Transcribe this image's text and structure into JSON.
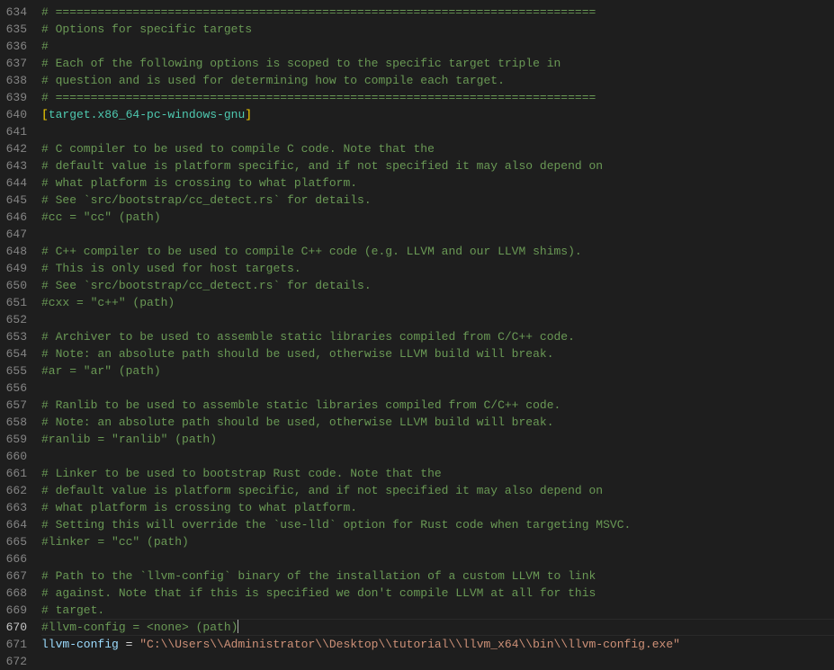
{
  "editor": {
    "startLine": 634,
    "currentLine": 670,
    "lines": [
      {
        "n": 634,
        "kind": "comment",
        "text": "# ============================================================================="
      },
      {
        "n": 635,
        "kind": "comment",
        "text": "# Options for specific targets"
      },
      {
        "n": 636,
        "kind": "comment",
        "text": "#"
      },
      {
        "n": 637,
        "kind": "comment",
        "text": "# Each of the following options is scoped to the specific target triple in"
      },
      {
        "n": 638,
        "kind": "comment",
        "text": "# question and is used for determining how to compile each target."
      },
      {
        "n": 639,
        "kind": "comment",
        "text": "# ============================================================================="
      },
      {
        "n": 640,
        "kind": "section",
        "open": "[",
        "name": "target.x86_64-pc-windows-gnu",
        "close": "]"
      },
      {
        "n": 641,
        "kind": "blank",
        "text": ""
      },
      {
        "n": 642,
        "kind": "comment",
        "text": "# C compiler to be used to compile C code. Note that the"
      },
      {
        "n": 643,
        "kind": "comment",
        "text": "# default value is platform specific, and if not specified it may also depend on"
      },
      {
        "n": 644,
        "kind": "comment",
        "text": "# what platform is crossing to what platform."
      },
      {
        "n": 645,
        "kind": "comment",
        "text": "# See `src/bootstrap/cc_detect.rs` for details."
      },
      {
        "n": 646,
        "kind": "comment",
        "text": "#cc = \"cc\" (path)"
      },
      {
        "n": 647,
        "kind": "blank",
        "text": ""
      },
      {
        "n": 648,
        "kind": "comment",
        "text": "# C++ compiler to be used to compile C++ code (e.g. LLVM and our LLVM shims)."
      },
      {
        "n": 649,
        "kind": "comment",
        "text": "# This is only used for host targets."
      },
      {
        "n": 650,
        "kind": "comment",
        "text": "# See `src/bootstrap/cc_detect.rs` for details."
      },
      {
        "n": 651,
        "kind": "comment",
        "text": "#cxx = \"c++\" (path)"
      },
      {
        "n": 652,
        "kind": "blank",
        "text": ""
      },
      {
        "n": 653,
        "kind": "comment",
        "text": "# Archiver to be used to assemble static libraries compiled from C/C++ code."
      },
      {
        "n": 654,
        "kind": "comment",
        "text": "# Note: an absolute path should be used, otherwise LLVM build will break."
      },
      {
        "n": 655,
        "kind": "comment",
        "text": "#ar = \"ar\" (path)"
      },
      {
        "n": 656,
        "kind": "blank",
        "text": ""
      },
      {
        "n": 657,
        "kind": "comment",
        "text": "# Ranlib to be used to assemble static libraries compiled from C/C++ code."
      },
      {
        "n": 658,
        "kind": "comment",
        "text": "# Note: an absolute path should be used, otherwise LLVM build will break."
      },
      {
        "n": 659,
        "kind": "comment",
        "text": "#ranlib = \"ranlib\" (path)"
      },
      {
        "n": 660,
        "kind": "blank",
        "text": ""
      },
      {
        "n": 661,
        "kind": "comment",
        "text": "# Linker to be used to bootstrap Rust code. Note that the"
      },
      {
        "n": 662,
        "kind": "comment",
        "text": "# default value is platform specific, and if not specified it may also depend on"
      },
      {
        "n": 663,
        "kind": "comment",
        "text": "# what platform is crossing to what platform."
      },
      {
        "n": 664,
        "kind": "comment",
        "text": "# Setting this will override the `use-lld` option for Rust code when targeting MSVC."
      },
      {
        "n": 665,
        "kind": "comment",
        "text": "#linker = \"cc\" (path)"
      },
      {
        "n": 666,
        "kind": "blank",
        "text": ""
      },
      {
        "n": 667,
        "kind": "comment",
        "text": "# Path to the `llvm-config` binary of the installation of a custom LLVM to link"
      },
      {
        "n": 668,
        "kind": "comment",
        "text": "# against. Note that if this is specified we don't compile LLVM at all for this"
      },
      {
        "n": 669,
        "kind": "comment",
        "text": "# target."
      },
      {
        "n": 670,
        "kind": "comment",
        "text": "#llvm-config = <none> (path)",
        "cursor": true
      },
      {
        "n": 671,
        "kind": "kv",
        "key": "llvm-config",
        "op": " = ",
        "value": "\"C:\\\\Users\\\\Administrator\\\\Desktop\\\\tutorial\\\\llvm_x64\\\\bin\\\\llvm-config.exe\""
      },
      {
        "n": 672,
        "kind": "blank",
        "text": ""
      }
    ]
  }
}
